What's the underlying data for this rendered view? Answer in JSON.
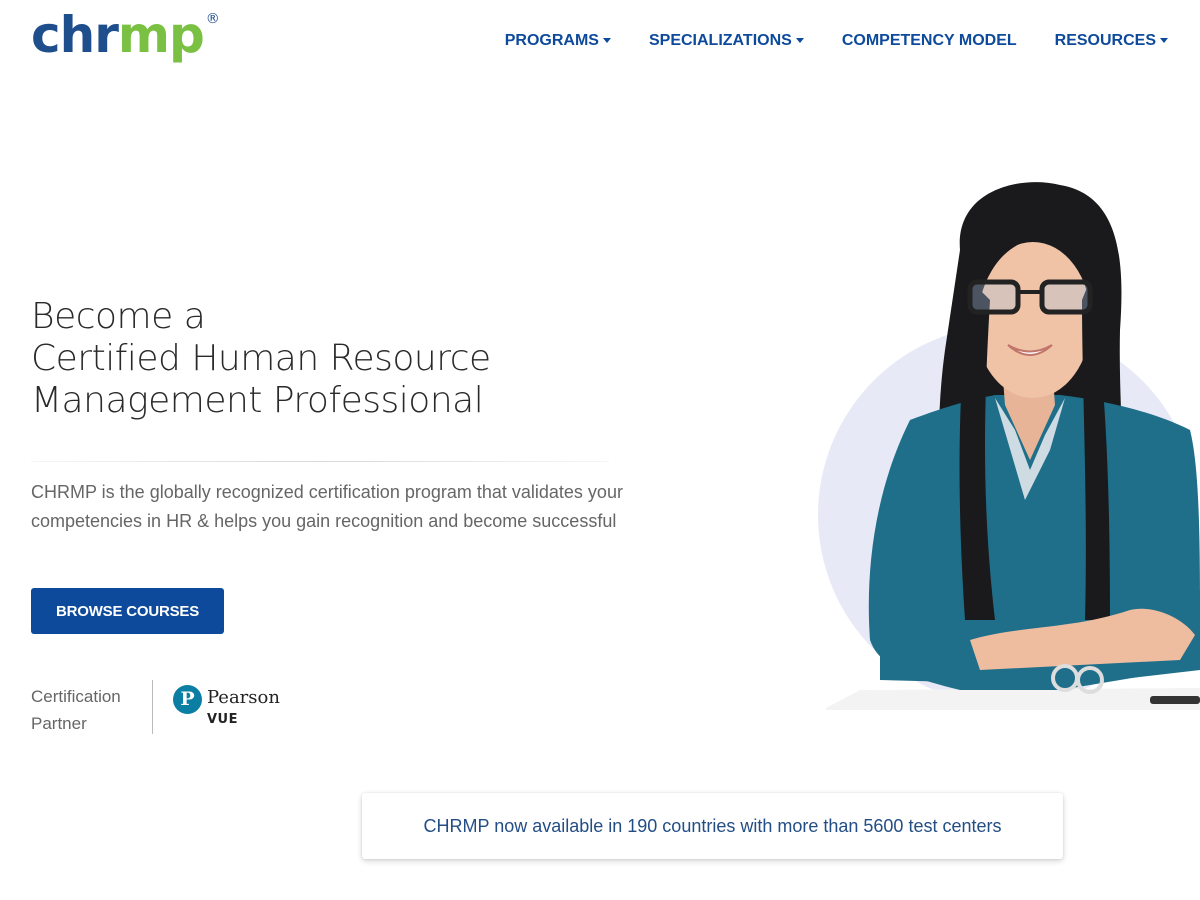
{
  "header": {
    "logo": {
      "part1": "chr",
      "part2": "mp",
      "registered": "®"
    },
    "nav": [
      {
        "label": "PROGRAMS",
        "dropdown": true
      },
      {
        "label": "SPECIALIZATIONS",
        "dropdown": true
      },
      {
        "label": "COMPETENCY MODEL",
        "dropdown": false
      },
      {
        "label": "RESOURCES",
        "dropdown": true
      }
    ]
  },
  "hero": {
    "title_lines": [
      "Become a",
      "Certified Human Resource",
      "Management Professional"
    ],
    "description": "CHRMP is the globally recognized certification program that validates your competencies in HR & helps you gain recognition and become successful",
    "cta_label": "BROWSE COURSES",
    "partner_label_lines": [
      "Certification",
      "Partner"
    ],
    "partner": {
      "icon_letter": "P",
      "name": "Pearson",
      "sub": "VUE"
    }
  },
  "info_banner": {
    "text": "CHRMP now available in 190 countries with more than 5600 test centers"
  },
  "colors": {
    "brand_blue": "#0d4a9b",
    "logo_blue": "#1f4e8c",
    "logo_green": "#7ac143",
    "circle_bg": "#e7e9f6",
    "pearson_teal": "#0b7ea3"
  },
  "icons": [
    "caret-down-icon",
    "pearson-logo-icon",
    "registered-mark"
  ]
}
